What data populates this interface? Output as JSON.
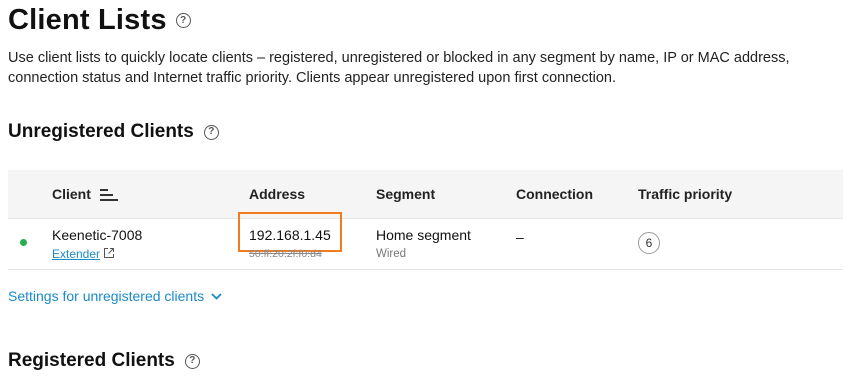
{
  "page": {
    "title": "Client Lists",
    "help_glyph": "?",
    "description": "Use client lists to quickly locate clients – registered, unregistered or blocked in any segment by name, IP or MAC address, connection status and Internet traffic priority. Clients appear unregistered upon first connection."
  },
  "unregistered": {
    "title": "Unregistered Clients",
    "columns": [
      "Client",
      "Address",
      "Segment",
      "Connection",
      "Traffic priority"
    ],
    "rows": [
      {
        "status_color": "#22b14c",
        "name": "Keenetic-7008",
        "link": "Extender",
        "ip": "192.168.1.45",
        "mac": "50:ff:20:2f:f0:d4",
        "segment": "Home segment",
        "segment_type": "Wired",
        "connection": "–",
        "priority": "6"
      }
    ],
    "settings_link": "Settings for unregistered clients"
  },
  "registered": {
    "title": "Registered Clients"
  },
  "colors": {
    "accent": "#1a8acb",
    "highlight": "#f07c22",
    "online": "#22b14c"
  },
  "icons": [
    "help-icon",
    "sort-icon",
    "external-link-icon",
    "chevron-down-icon"
  ]
}
